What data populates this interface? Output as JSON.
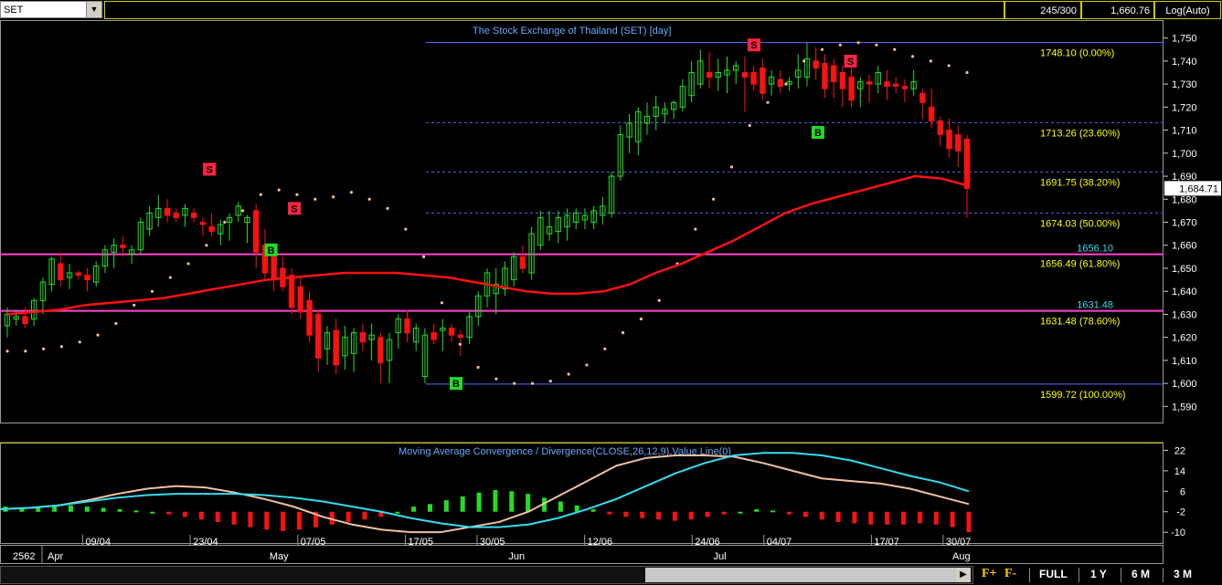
{
  "toolbar": {
    "symbol": "SET",
    "bar_count": "245/300",
    "last_price": "1,660.76",
    "scale_mode": "Log(Auto)"
  },
  "bottom": {
    "fplus": "F+",
    "fminus": "F-",
    "ranges": [
      "FULL",
      "1 Y",
      "6 M",
      "3 M"
    ]
  },
  "colors": {
    "up": "#22dd22",
    "down": "#ff1111",
    "ma": "#ff1111",
    "sar": "#f0c090",
    "fib_text": "#ffff00",
    "level": "#ff44cc",
    "macd_line": "#33ddee",
    "signal_line": "#f0c0a0"
  },
  "chart_data": [
    {
      "type": "candlestick",
      "title": "The Stock Exchange of Thailand (SET) [day]",
      "ylim": [
        1583,
        1757
      ],
      "y_ticks": [
        1590,
        1600,
        1610,
        1620,
        1630,
        1640,
        1650,
        1660,
        1670,
        1680,
        1690,
        1700,
        1710,
        1720,
        1730,
        1740,
        1750
      ],
      "y_tick_labels": [
        "1,590",
        "1,600",
        "1,610",
        "1,620",
        "1,630",
        "1,640",
        "1,650",
        "1,660",
        "1,670",
        "1,680",
        "1,690",
        "1,700",
        "1,710",
        "1,720",
        "1,730",
        "1,740",
        "1,750"
      ],
      "last_value": 1684.71,
      "last_label": "1,684.71",
      "x_year_label": "2562",
      "month_labels": [
        {
          "label": "Apr",
          "i": 1
        },
        {
          "label": "May",
          "i": 8
        },
        {
          "label": "Jun",
          "i": 15
        },
        {
          "label": "Jul",
          "i": 21
        },
        {
          "label": "Aug",
          "i": 28
        }
      ],
      "date_labels": [
        {
          "label": "09/04",
          "i": 2
        },
        {
          "label": "23/04",
          "i": 5
        },
        {
          "label": "07/05",
          "i": 8
        },
        {
          "label": "17/05",
          "i": 11
        },
        {
          "label": "30/05",
          "i": 13
        },
        {
          "label": "12/06",
          "i": 16
        },
        {
          "label": "24/06",
          "i": 19
        },
        {
          "label": "04/07",
          "i": 21
        },
        {
          "label": "17/07",
          "i": 24
        },
        {
          "label": "30/07",
          "i": 26
        }
      ],
      "candles": [
        {
          "o": 1625,
          "h": 1633,
          "l": 1620,
          "c": 1630
        },
        {
          "o": 1628,
          "h": 1632,
          "l": 1625,
          "c": 1629
        },
        {
          "o": 1629,
          "h": 1633,
          "l": 1624,
          "c": 1626
        },
        {
          "o": 1628,
          "h": 1637,
          "l": 1625,
          "c": 1636
        },
        {
          "o": 1636,
          "h": 1646,
          "l": 1630,
          "c": 1644
        },
        {
          "o": 1643,
          "h": 1655,
          "l": 1640,
          "c": 1654
        },
        {
          "o": 1652,
          "h": 1657,
          "l": 1642,
          "c": 1645
        },
        {
          "o": 1646,
          "h": 1652,
          "l": 1641,
          "c": 1648
        },
        {
          "o": 1648,
          "h": 1649,
          "l": 1645,
          "c": 1647
        },
        {
          "o": 1647,
          "h": 1650,
          "l": 1640,
          "c": 1645
        },
        {
          "o": 1644,
          "h": 1653,
          "l": 1642,
          "c": 1651
        },
        {
          "o": 1651,
          "h": 1660,
          "l": 1648,
          "c": 1658
        },
        {
          "o": 1657,
          "h": 1663,
          "l": 1650,
          "c": 1660
        },
        {
          "o": 1660,
          "h": 1664,
          "l": 1655,
          "c": 1659
        },
        {
          "o": 1656,
          "h": 1660,
          "l": 1652,
          "c": 1658
        },
        {
          "o": 1658,
          "h": 1672,
          "l": 1656,
          "c": 1670
        },
        {
          "o": 1667,
          "h": 1677,
          "l": 1664,
          "c": 1674
        },
        {
          "o": 1672,
          "h": 1682,
          "l": 1668,
          "c": 1676
        },
        {
          "o": 1676,
          "h": 1680,
          "l": 1670,
          "c": 1673
        },
        {
          "o": 1674,
          "h": 1676,
          "l": 1670,
          "c": 1672
        },
        {
          "o": 1673,
          "h": 1678,
          "l": 1668,
          "c": 1676
        },
        {
          "o": 1674,
          "h": 1676,
          "l": 1670,
          "c": 1672
        },
        {
          "o": 1670,
          "h": 1672,
          "l": 1664,
          "c": 1669
        },
        {
          "o": 1668,
          "h": 1674,
          "l": 1664,
          "c": 1666
        },
        {
          "o": 1665,
          "h": 1671,
          "l": 1660,
          "c": 1669
        },
        {
          "o": 1670,
          "h": 1674,
          "l": 1662,
          "c": 1672
        },
        {
          "o": 1673,
          "h": 1679,
          "l": 1670,
          "c": 1677
        },
        {
          "o": 1670,
          "h": 1673,
          "l": 1661,
          "c": 1672
        },
        {
          "o": 1675,
          "h": 1678,
          "l": 1650,
          "c": 1657
        },
        {
          "o": 1660,
          "h": 1667,
          "l": 1645,
          "c": 1648
        },
        {
          "o": 1655,
          "h": 1660,
          "l": 1640,
          "c": 1645
        },
        {
          "o": 1650,
          "h": 1655,
          "l": 1640,
          "c": 1642
        },
        {
          "o": 1647,
          "h": 1650,
          "l": 1630,
          "c": 1633
        },
        {
          "o": 1642,
          "h": 1646,
          "l": 1628,
          "c": 1631
        },
        {
          "o": 1636,
          "h": 1640,
          "l": 1618,
          "c": 1621
        },
        {
          "o": 1630,
          "h": 1632,
          "l": 1605,
          "c": 1611
        },
        {
          "o": 1615,
          "h": 1625,
          "l": 1608,
          "c": 1622
        },
        {
          "o": 1623,
          "h": 1628,
          "l": 1604,
          "c": 1608
        },
        {
          "o": 1612,
          "h": 1625,
          "l": 1606,
          "c": 1620
        },
        {
          "o": 1613,
          "h": 1624,
          "l": 1605,
          "c": 1622
        },
        {
          "o": 1622,
          "h": 1626,
          "l": 1614,
          "c": 1618
        },
        {
          "o": 1619,
          "h": 1626,
          "l": 1610,
          "c": 1621
        },
        {
          "o": 1620,
          "h": 1622,
          "l": 1600,
          "c": 1609
        },
        {
          "o": 1610,
          "h": 1622,
          "l": 1600,
          "c": 1619
        },
        {
          "o": 1622,
          "h": 1630,
          "l": 1615,
          "c": 1628
        },
        {
          "o": 1628,
          "h": 1632,
          "l": 1618,
          "c": 1622
        },
        {
          "o": 1618,
          "h": 1626,
          "l": 1614,
          "c": 1624
        },
        {
          "o": 1603,
          "h": 1624,
          "l": 1600,
          "c": 1621
        },
        {
          "o": 1622,
          "h": 1626,
          "l": 1617,
          "c": 1619
        },
        {
          "o": 1623,
          "h": 1628,
          "l": 1614,
          "c": 1624
        },
        {
          "o": 1624,
          "h": 1626,
          "l": 1618,
          "c": 1621
        },
        {
          "o": 1621,
          "h": 1623,
          "l": 1612,
          "c": 1620
        },
        {
          "o": 1620,
          "h": 1631,
          "l": 1617,
          "c": 1629
        },
        {
          "o": 1629,
          "h": 1640,
          "l": 1625,
          "c": 1638
        },
        {
          "o": 1638,
          "h": 1650,
          "l": 1633,
          "c": 1648
        },
        {
          "o": 1639,
          "h": 1650,
          "l": 1630,
          "c": 1643
        },
        {
          "o": 1641,
          "h": 1653,
          "l": 1638,
          "c": 1650
        },
        {
          "o": 1645,
          "h": 1657,
          "l": 1642,
          "c": 1655
        },
        {
          "o": 1655,
          "h": 1660,
          "l": 1648,
          "c": 1650
        },
        {
          "o": 1648,
          "h": 1668,
          "l": 1645,
          "c": 1665
        },
        {
          "o": 1660,
          "h": 1675,
          "l": 1658,
          "c": 1672
        },
        {
          "o": 1665,
          "h": 1675,
          "l": 1662,
          "c": 1668
        },
        {
          "o": 1666,
          "h": 1675,
          "l": 1661,
          "c": 1672
        },
        {
          "o": 1668,
          "h": 1676,
          "l": 1662,
          "c": 1673
        },
        {
          "o": 1670,
          "h": 1676,
          "l": 1667,
          "c": 1674
        },
        {
          "o": 1671,
          "h": 1676,
          "l": 1667,
          "c": 1673
        },
        {
          "o": 1670,
          "h": 1677,
          "l": 1667,
          "c": 1675
        },
        {
          "o": 1673,
          "h": 1681,
          "l": 1669,
          "c": 1677
        },
        {
          "o": 1674,
          "h": 1692,
          "l": 1672,
          "c": 1690
        },
        {
          "o": 1690,
          "h": 1712,
          "l": 1688,
          "c": 1708
        },
        {
          "o": 1707,
          "h": 1717,
          "l": 1700,
          "c": 1713
        },
        {
          "o": 1705,
          "h": 1720,
          "l": 1699,
          "c": 1718
        },
        {
          "o": 1713,
          "h": 1722,
          "l": 1708,
          "c": 1716
        },
        {
          "o": 1716,
          "h": 1725,
          "l": 1710,
          "c": 1720
        },
        {
          "o": 1717,
          "h": 1722,
          "l": 1713,
          "c": 1719
        },
        {
          "o": 1719,
          "h": 1723,
          "l": 1715,
          "c": 1722
        },
        {
          "o": 1720,
          "h": 1732,
          "l": 1718,
          "c": 1729
        },
        {
          "o": 1725,
          "h": 1740,
          "l": 1722,
          "c": 1735
        },
        {
          "o": 1730,
          "h": 1745,
          "l": 1728,
          "c": 1740
        },
        {
          "o": 1735,
          "h": 1744,
          "l": 1728,
          "c": 1733
        },
        {
          "o": 1733,
          "h": 1741,
          "l": 1727,
          "c": 1735
        },
        {
          "o": 1734,
          "h": 1742,
          "l": 1726,
          "c": 1736
        },
        {
          "o": 1736,
          "h": 1740,
          "l": 1730,
          "c": 1738
        },
        {
          "o": 1735,
          "h": 1742,
          "l": 1718,
          "c": 1733
        },
        {
          "o": 1735,
          "h": 1738,
          "l": 1727,
          "c": 1730
        },
        {
          "o": 1737,
          "h": 1741,
          "l": 1723,
          "c": 1726
        },
        {
          "o": 1730,
          "h": 1736,
          "l": 1725,
          "c": 1733
        },
        {
          "o": 1732,
          "h": 1736,
          "l": 1726,
          "c": 1729
        },
        {
          "o": 1730,
          "h": 1733,
          "l": 1727,
          "c": 1731
        },
        {
          "o": 1733,
          "h": 1743,
          "l": 1728,
          "c": 1736
        },
        {
          "o": 1733,
          "h": 1748,
          "l": 1729,
          "c": 1741
        },
        {
          "o": 1740,
          "h": 1746,
          "l": 1732,
          "c": 1737
        },
        {
          "o": 1739,
          "h": 1743,
          "l": 1724,
          "c": 1728
        },
        {
          "o": 1738,
          "h": 1741,
          "l": 1724,
          "c": 1731
        },
        {
          "o": 1735,
          "h": 1738,
          "l": 1720,
          "c": 1728
        },
        {
          "o": 1733,
          "h": 1737,
          "l": 1720,
          "c": 1723
        },
        {
          "o": 1728,
          "h": 1733,
          "l": 1720,
          "c": 1731
        },
        {
          "o": 1731,
          "h": 1734,
          "l": 1722,
          "c": 1730
        },
        {
          "o": 1730,
          "h": 1738,
          "l": 1726,
          "c": 1735
        },
        {
          "o": 1731,
          "h": 1736,
          "l": 1723,
          "c": 1729
        },
        {
          "o": 1730,
          "h": 1733,
          "l": 1726,
          "c": 1729
        },
        {
          "o": 1729,
          "h": 1732,
          "l": 1722,
          "c": 1728
        },
        {
          "o": 1728,
          "h": 1736,
          "l": 1725,
          "c": 1731
        },
        {
          "o": 1726,
          "h": 1728,
          "l": 1715,
          "c": 1722
        },
        {
          "o": 1720,
          "h": 1728,
          "l": 1711,
          "c": 1714
        },
        {
          "o": 1714,
          "h": 1716,
          "l": 1703,
          "c": 1708
        },
        {
          "o": 1710,
          "h": 1715,
          "l": 1698,
          "c": 1702
        },
        {
          "o": 1708,
          "h": 1712,
          "l": 1694,
          "c": 1701
        },
        {
          "o": 1706,
          "h": 1708,
          "l": 1672,
          "c": 1684.71
        }
      ],
      "ma": [
        1630,
        1631,
        1632,
        1634,
        1635,
        1636,
        1637,
        1639,
        1641,
        1643,
        1645,
        1646,
        1647,
        1648,
        1648,
        1648,
        1647,
        1646,
        1644,
        1642,
        1640,
        1639,
        1639,
        1640,
        1643,
        1648,
        1652,
        1657,
        1662,
        1668,
        1674,
        1678,
        1681,
        1684,
        1687,
        1690,
        1689,
        1686
      ],
      "sar": [
        1614,
        1614,
        1615,
        1616,
        1618,
        1621,
        1626,
        1634,
        1640,
        1646,
        1652,
        1660,
        1670,
        1675,
        1682,
        1684,
        1682,
        1680,
        1681,
        1683,
        1680,
        1676,
        1667,
        1655,
        1635,
        1617,
        1607,
        1602,
        1600,
        1600,
        1601,
        1604,
        1608,
        1615,
        1622,
        1628,
        1636,
        1652,
        1667,
        1680,
        1694,
        1712,
        1722,
        1730,
        1740,
        1745,
        1747,
        1748,
        1747,
        1745,
        1742,
        1740,
        1738,
        1735
      ],
      "signals": [
        {
          "label": "S",
          "x_frac": 0.18,
          "price": 1693,
          "color": "#ff2244"
        },
        {
          "label": "S",
          "x_frac": 0.253,
          "price": 1676,
          "color": "#ff2244"
        },
        {
          "label": "B",
          "x_frac": 0.233,
          "price": 1658,
          "color": "#22dd22"
        },
        {
          "label": "B",
          "x_frac": 0.392,
          "price": 1600,
          "color": "#22dd22"
        },
        {
          "label": "S",
          "x_frac": 0.648,
          "price": 1747,
          "color": "#ff2244"
        },
        {
          "label": "S",
          "x_frac": 0.731,
          "price": 1740,
          "color": "#ff2244"
        },
        {
          "label": "B",
          "x_frac": 0.703,
          "price": 1709,
          "color": "#22dd22"
        }
      ],
      "fib_levels": [
        {
          "price": 1748.1,
          "label": "1748.10 (0.00%)",
          "style": "solid"
        },
        {
          "price": 1713.26,
          "label": "1713.26 (23.60%)",
          "style": "dashed"
        },
        {
          "price": 1691.75,
          "label": "1691.75 (38.20%)",
          "style": "dashed"
        },
        {
          "price": 1674.03,
          "label": "1674.03 (50.00%)",
          "style": "dashed"
        },
        {
          "price": 1656.49,
          "label": "1656.49 (61.80%)",
          "style": "solid"
        },
        {
          "price": 1631.48,
          "label": "1631.48 (78.60%)",
          "style": "dashed"
        },
        {
          "price": 1599.72,
          "label": "1599.72 (100.00%)",
          "style": "solid"
        }
      ],
      "hlines": [
        {
          "price": 1656.1,
          "label": "1656.10"
        },
        {
          "price": 1631.48,
          "label": "1631.48"
        }
      ]
    },
    {
      "type": "macd",
      "title": "Moving Average Convergence / Divergence(CLOSE,26,12,9),Value Line(0)",
      "ylim": [
        -13.5,
        25
      ],
      "y_ticks": [
        22,
        14,
        6,
        -2,
        -10
      ],
      "y_tick_labels": [
        "22",
        "14",
        "6",
        "-2",
        "-10"
      ],
      "macd_line": [
        -1,
        -0.5,
        0.5,
        2,
        3.5,
        4.5,
        5,
        5,
        5,
        4.5,
        3.5,
        2,
        0,
        -2,
        -4.5,
        -6.5,
        -8,
        -8,
        -7,
        -4.5,
        -1,
        3,
        8,
        13,
        17,
        20,
        21,
        21,
        20,
        18,
        15,
        12,
        9.5,
        6
      ],
      "signal_line": [
        -1,
        -0.5,
        0.5,
        2.5,
        5,
        7,
        8,
        7.5,
        5.5,
        3,
        0,
        -4,
        -7,
        -9,
        -10,
        -10,
        -8,
        -6,
        -2,
        4,
        10,
        16,
        19,
        20,
        20,
        19.5,
        17,
        14,
        11,
        10,
        9,
        7,
        4,
        1
      ],
      "histogram": [
        2,
        1.5,
        2,
        2.5,
        2.5,
        2,
        1.5,
        1,
        0.5,
        0,
        -1,
        -2,
        -3,
        -4,
        -5,
        -6,
        -7,
        -7.5,
        -7,
        -6,
        -5,
        -4,
        -3,
        -2,
        0,
        2,
        3,
        4.5,
        6,
        7.5,
        8.5,
        8,
        7,
        5.5,
        4,
        2.5,
        1,
        -1,
        -2,
        -2.5,
        -3,
        -3.5,
        -3,
        -2,
        -1,
        0,
        1,
        0.5,
        -1,
        -2,
        -3,
        -4,
        -4.5,
        -5,
        -5,
        -5,
        -4.5,
        -5,
        -6,
        -8
      ]
    }
  ]
}
